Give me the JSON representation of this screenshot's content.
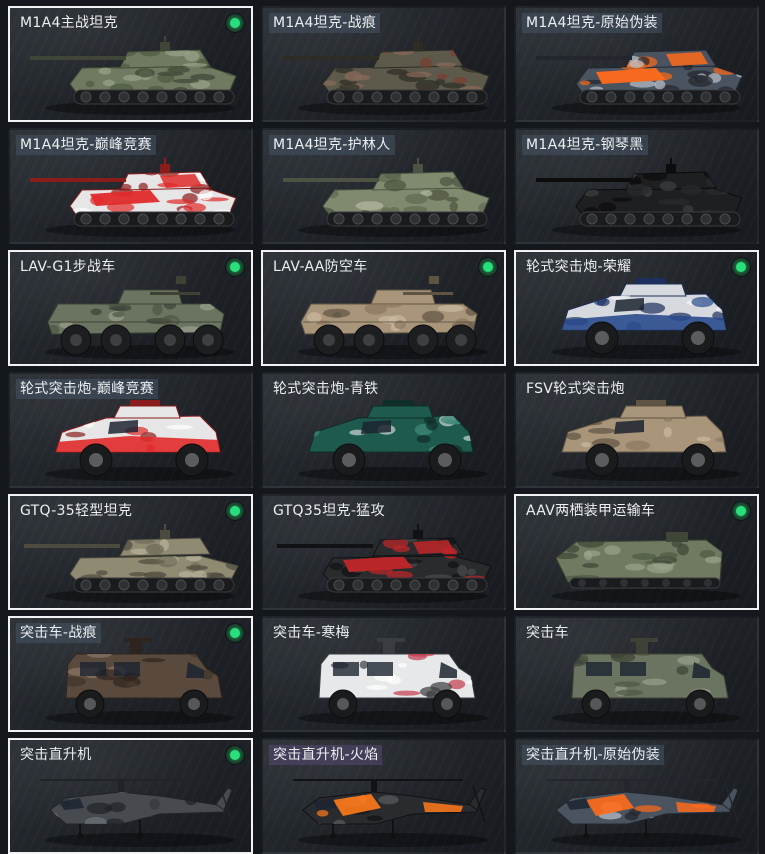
{
  "vehicles": [
    {
      "name": "M1A4主战坦克",
      "kind": "tank",
      "camo": "woodland-green",
      "owned": true,
      "selected": true,
      "tint": "none"
    },
    {
      "name": "M1A4坦克-战痕",
      "kind": "tank",
      "camo": "scarred-woodland",
      "owned": false,
      "selected": false,
      "tint": "blue"
    },
    {
      "name": "M1A4坦克-原始伪装",
      "kind": "tank",
      "camo": "orange-digital",
      "owned": false,
      "selected": false,
      "tint": "blue"
    },
    {
      "name": "M1A4坦克-巅峰竞赛",
      "kind": "tank",
      "camo": "red-white-race",
      "owned": false,
      "selected": false,
      "tint": "blue"
    },
    {
      "name": "M1A4坦克-护林人",
      "kind": "tank",
      "camo": "forest-ranger",
      "owned": false,
      "selected": false,
      "tint": "blue"
    },
    {
      "name": "M1A4坦克-钢琴黑",
      "kind": "tank",
      "camo": "piano-black",
      "owned": false,
      "selected": false,
      "tint": "blue"
    },
    {
      "name": "LAV-G1步战车",
      "kind": "apc",
      "camo": "olive-green",
      "owned": true,
      "selected": true,
      "tint": "none"
    },
    {
      "name": "LAV-AA防空车",
      "kind": "apc",
      "camo": "desert-tan",
      "owned": true,
      "selected": true,
      "tint": "none"
    },
    {
      "name": "轮式突击炮-荣耀",
      "kind": "wheeled",
      "camo": "navy-white",
      "owned": true,
      "selected": true,
      "tint": "none"
    },
    {
      "name": "轮式突击炮-巅峰竞赛",
      "kind": "wheeled",
      "camo": "red-white-race",
      "owned": false,
      "selected": false,
      "tint": "blue"
    },
    {
      "name": "轮式突击炮-青铁",
      "kind": "wheeled",
      "camo": "teal-iron",
      "owned": false,
      "selected": false,
      "tint": "none"
    },
    {
      "name": "FSV轮式突击炮",
      "kind": "wheeled",
      "camo": "desert-tan",
      "owned": false,
      "selected": false,
      "tint": "none"
    },
    {
      "name": "GTQ-35轻型坦克",
      "kind": "lighttank",
      "camo": "desert-olive",
      "owned": true,
      "selected": true,
      "tint": "none"
    },
    {
      "name": "GTQ35坦克-猛攻",
      "kind": "lighttank",
      "camo": "black-red",
      "owned": false,
      "selected": false,
      "tint": "none"
    },
    {
      "name": "AAV两栖装甲运输车",
      "kind": "amphibious",
      "camo": "woodland-green",
      "owned": true,
      "selected": true,
      "tint": "none"
    },
    {
      "name": "突击车-战痕",
      "kind": "truck",
      "camo": "brown-scarred",
      "owned": true,
      "selected": true,
      "tint": "blue"
    },
    {
      "name": "突击车-寒梅",
      "kind": "truck",
      "camo": "white-plum",
      "owned": false,
      "selected": false,
      "tint": "none"
    },
    {
      "name": "突击车",
      "kind": "truck",
      "camo": "olive-green",
      "owned": false,
      "selected": false,
      "tint": "none"
    },
    {
      "name": "突击直升机",
      "kind": "heli",
      "camo": "dark-grey",
      "owned": true,
      "selected": true,
      "tint": "none"
    },
    {
      "name": "突击直升机-火焰",
      "kind": "heli",
      "camo": "black-flame",
      "owned": false,
      "selected": false,
      "tint": "purple"
    },
    {
      "name": "突击直升机-原始伪装",
      "kind": "heli",
      "camo": "orange-digital",
      "owned": false,
      "selected": false,
      "tint": "blue"
    }
  ],
  "palette": {
    "woodland-green": {
      "base": "#6f7a60",
      "dark": "#3f4636",
      "light": "#9aa48a",
      "accent": "#4d5a42"
    },
    "scarred-woodland": {
      "base": "#5d5a4c",
      "dark": "#2e2c25",
      "light": "#8a6a5a",
      "accent": "#7a3d30"
    },
    "orange-digital": {
      "base": "#4a5460",
      "dark": "#23272d",
      "light": "#b9c2cc",
      "accent": "#ff6a1a"
    },
    "red-white-race": {
      "base": "#e6e6e6",
      "dark": "#8a1c1c",
      "light": "#ffffff",
      "accent": "#e02a2a"
    },
    "forest-ranger": {
      "base": "#7f8a6e",
      "dark": "#4c5342",
      "light": "#b3b8a3",
      "accent": "#5f6a50"
    },
    "piano-black": {
      "base": "#1e1f21",
      "dark": "#0c0c0d",
      "light": "#3c3e42",
      "accent": "#2a2b2e"
    },
    "olive-green": {
      "base": "#6b7460",
      "dark": "#3c4236",
      "light": "#9aa08e",
      "accent": "#4f5645"
    },
    "desert-tan": {
      "base": "#a8957a",
      "dark": "#5f5443",
      "light": "#cbbba0",
      "accent": "#8a7860"
    },
    "navy-white": {
      "base": "#d6d9dd",
      "dark": "#1d2f5c",
      "light": "#f2f3f5",
      "accent": "#2a4a8c"
    },
    "teal-iron": {
      "base": "#1e5a4e",
      "dark": "#0f2e28",
      "light": "#3f8a7a",
      "accent": "#c9d6d2"
    },
    "desert-olive": {
      "base": "#8f8a72",
      "dark": "#4d4a3e",
      "light": "#b9b49c",
      "accent": "#6e6a56"
    },
    "black-red": {
      "base": "#2a2b2d",
      "dark": "#111214",
      "light": "#4a4b4e",
      "accent": "#c0262a"
    },
    "brown-scarred": {
      "base": "#5a4a3e",
      "dark": "#2d241d",
      "light": "#8a7666",
      "accent": "#3e342b"
    },
    "white-plum": {
      "base": "#e7e8ea",
      "dark": "#3a3c40",
      "light": "#ffffff",
      "accent": "#c23a4a"
    },
    "dark-grey": {
      "base": "#474b50",
      "dark": "#202327",
      "light": "#6e7379",
      "accent": "#33373b"
    },
    "black-flame": {
      "base": "#2a2b2e",
      "dark": "#111214",
      "light": "#5a5c60",
      "accent": "#ff7a1a"
    }
  },
  "colors": {
    "selected_border": "#f2f2f2",
    "owned_indicator": "#27e07a",
    "label_text": "#eceff1"
  }
}
